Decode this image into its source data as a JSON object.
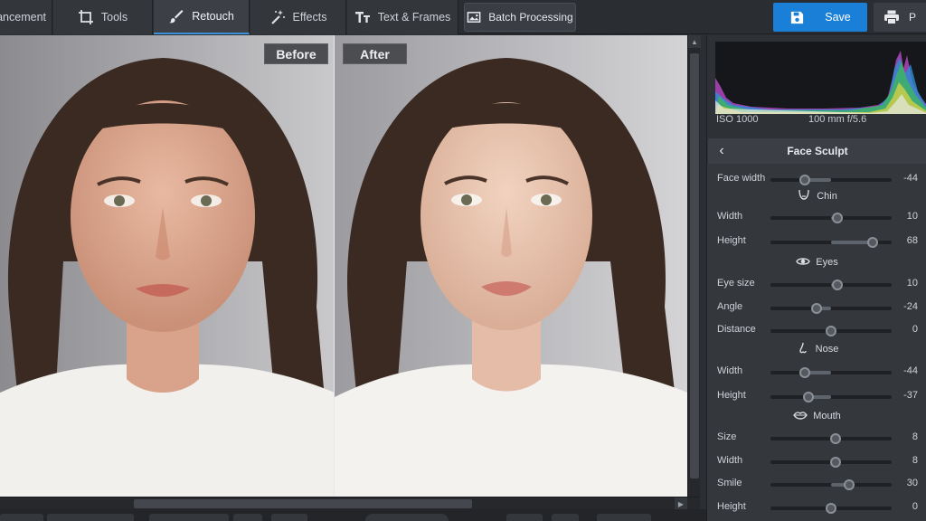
{
  "toolbar": {
    "tabs": [
      {
        "label": "nancement",
        "icon": "enhance-icon"
      },
      {
        "label": "Tools",
        "icon": "crop-icon"
      },
      {
        "label": "Retouch",
        "icon": "brush-icon"
      },
      {
        "label": "Effects",
        "icon": "magic-wand-icon"
      },
      {
        "label": "Text & Frames",
        "icon": "text-icon"
      }
    ],
    "batch_label": "Batch Processing",
    "save_label": "Save",
    "print_label": "P",
    "accent": "#1a7fd6"
  },
  "canvas": {
    "before_label": "Before",
    "after_label": "After"
  },
  "info": {
    "iso": "ISO 1000",
    "lens": "100 mm f/5.6"
  },
  "panel": {
    "title": "Face Sculpt",
    "rows": [
      {
        "label": "Face width",
        "value": "-44",
        "level": -44
      },
      {
        "group": "Chin",
        "icon": "chin-icon"
      },
      {
        "label": "Width",
        "value": "10",
        "level": 10
      },
      {
        "label": "Height",
        "value": "68",
        "level": 68
      },
      {
        "group": "Eyes",
        "icon": "eye-icon"
      },
      {
        "label": "Eye size",
        "value": "10",
        "level": 10
      },
      {
        "label": "Angle",
        "value": "-24",
        "level": -24
      },
      {
        "label": "Distance",
        "value": "0",
        "level": 0
      },
      {
        "group": "Nose",
        "icon": "nose-icon"
      },
      {
        "label": "Width",
        "value": "-44",
        "level": -44
      },
      {
        "label": "Height",
        "value": "-37",
        "level": -37
      },
      {
        "group": "Mouth",
        "icon": "lips-icon"
      },
      {
        "label": "Size",
        "value": "8",
        "level": 8
      },
      {
        "label": "Width",
        "value": "8",
        "level": 8
      },
      {
        "label": "Smile",
        "value": "30",
        "level": 30
      },
      {
        "label": "Height",
        "value": "0",
        "level": 0
      }
    ]
  }
}
